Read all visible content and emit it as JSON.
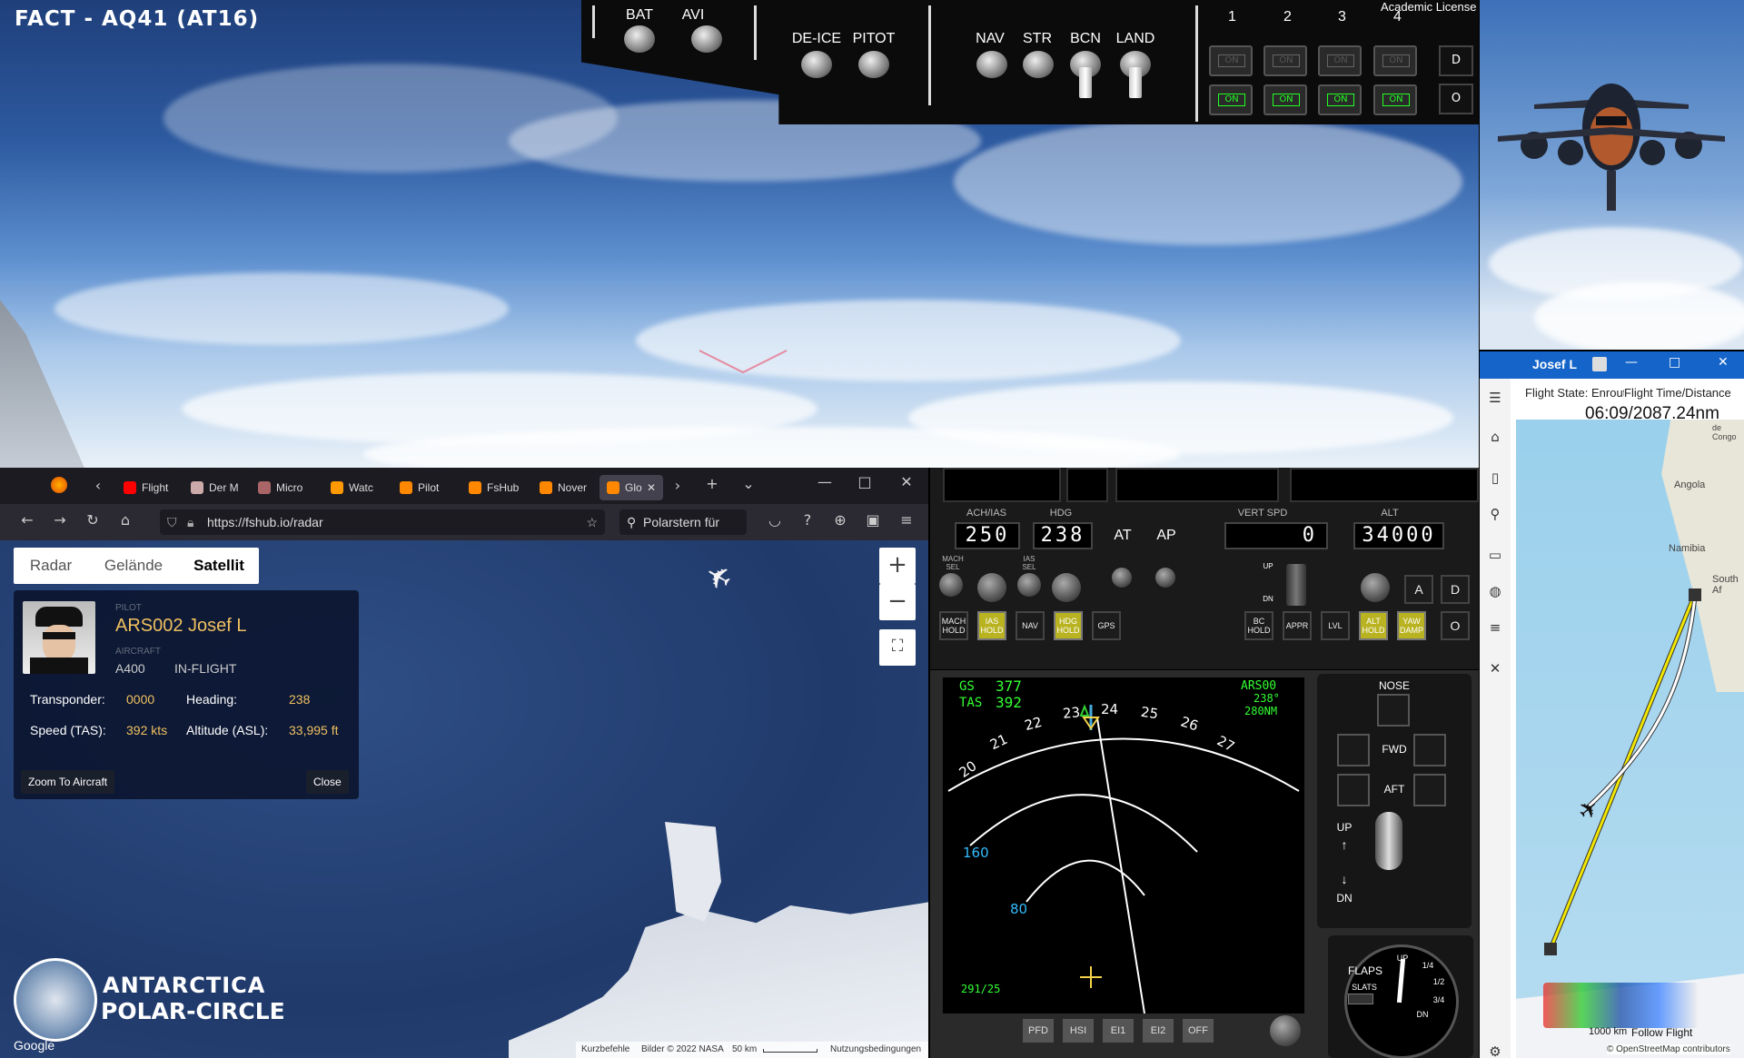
{
  "sim": {
    "title": "FACT - AQ41 (AT16)",
    "license": "Academic License",
    "overhead": {
      "switches": [
        "BAT",
        "AVI",
        "DE-ICE",
        "PITOT",
        "NAV",
        "STR",
        "BCN",
        "LAND"
      ],
      "engines": [
        "1",
        "2",
        "3",
        "4"
      ],
      "on_label": "ON",
      "side_buttons": [
        "D",
        "O"
      ]
    }
  },
  "app": {
    "title": "Josef L",
    "flight_state": "Flight State: Enroute",
    "flight_time_label": "Flight Time/Distance",
    "flight_time_value": "06:09/2087.24nm",
    "map_labels": [
      "Angola",
      "Namibia",
      "South Af",
      "de Congo"
    ],
    "scale": "1000 km",
    "follow": "Follow Flight",
    "osm": "© OpenStreetMap contributors"
  },
  "browser": {
    "tabs": [
      "Flight",
      "Der M",
      "Micro",
      "Watc",
      "Pilot",
      "FsHub",
      "Nover",
      "Glo"
    ],
    "url": "https://fshub.io/radar",
    "search": "Polarstern für"
  },
  "radar": {
    "map_tabs": [
      "Radar",
      "Gelände",
      "Satellit"
    ],
    "active_tab": "Satellit",
    "pilot_label": "PILOT",
    "pilot_name": "ARS002 Josef L",
    "aircraft_label": "AIRCRAFT",
    "aircraft": "A400",
    "status": "IN-FLIGHT",
    "transponder_label": "Transponder:",
    "transponder": "0000",
    "heading_label": "Heading:",
    "heading": "238",
    "speed_label": "Speed (TAS):",
    "speed": "392 kts",
    "altitude_label": "Altitude (ASL):",
    "altitude": "33,995 ft",
    "zoom_btn": "Zoom To Aircraft",
    "close_btn": "Close",
    "footer": {
      "shortcuts": "Kurzbefehle",
      "imagery": "Bilder © 2022 NASA",
      "scale": "50 km",
      "terms": "Nutzungsbedingungen"
    },
    "brand_line1": "ANTARCTICA",
    "brand_line2": "POLAR-CIRCLE",
    "google": "Google"
  },
  "autopilot": {
    "labels": {
      "ias": "ACH/IAS",
      "hdg": "HDG",
      "vs": "VERT SPD",
      "alt": "ALT",
      "at": "AT",
      "ap": "AP",
      "up": "UP",
      "dn": "DN"
    },
    "ias": "250",
    "hdg": "238",
    "vs": "0",
    "alt": "34000",
    "small": {
      "mach_sel": "MACH SEL",
      "ias_sel": "IAS SEL"
    },
    "buttons": [
      {
        "label": "MACH HOLD",
        "on": false
      },
      {
        "label": "IAS HOLD",
        "on": true
      },
      {
        "label": "NAV",
        "on": false
      },
      {
        "label": "HDG HOLD",
        "on": true
      },
      {
        "label": "GPS",
        "on": false
      },
      {
        "label": "BC HOLD",
        "on": false
      },
      {
        "label": "APPR",
        "on": false
      },
      {
        "label": "LVL",
        "on": false
      },
      {
        "label": "ALT HOLD",
        "on": true
      },
      {
        "label": "YAW DAMP",
        "on": true
      }
    ],
    "side": [
      "A",
      "D",
      "O"
    ]
  },
  "nd": {
    "gs_label": "GS",
    "gs": "377",
    "tas_label": "TAS",
    "tas": "392",
    "wpt": "ARS00",
    "wpt_brg": "238°",
    "wpt_dist": "280NM",
    "ticks": [
      "20",
      "21",
      "22",
      "23",
      "24",
      "25",
      "26",
      "27"
    ],
    "ring1": "160",
    "ring2": "80",
    "wind": "291/25",
    "buttons": [
      "PFD",
      "HSI",
      "EI1",
      "EI2",
      "OFF"
    ]
  },
  "flaps_panel": {
    "nose": "NOSE",
    "fwd": "FWD",
    "aft": "AFT",
    "up": "UP",
    "dn": "DN",
    "flaps": "FLAPS",
    "slats": "SLATS",
    "marks": [
      "UP",
      "1/4",
      "1/2",
      "3/4",
      "DN"
    ]
  }
}
